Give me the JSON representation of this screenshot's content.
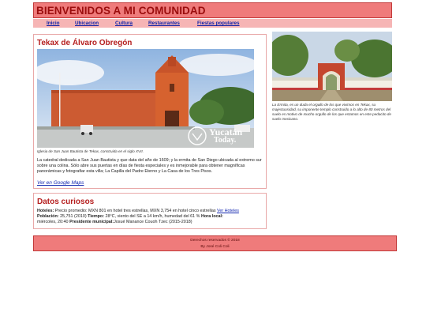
{
  "header": {
    "title": "BIENVENIDOS A MI COMUNIDAD"
  },
  "nav": {
    "items": [
      {
        "label": "Inicio"
      },
      {
        "label": "Ubicacion"
      },
      {
        "label": "Cultura"
      },
      {
        "label": "Restaurantes"
      },
      {
        "label": "Fiestas populares"
      }
    ]
  },
  "main": {
    "title": "Tekax de Álvaro Obregón",
    "photo_caption": "Iglesia de San Juan Bautista de Tekax, construida en el siglo XVII.",
    "watermark": {
      "brand": "Yucatán",
      "suffix": "Today."
    },
    "description": "La catedral dedicada a San Juan Bautista y que data del año de 1609; y la ermita de San Diego ubicada al extremo sur sobre una colina. Sólo abre sus puertas en días de fiesta especiales y es inmejorable para obtener magníficas panorámicas y fotografiar esta villa; La Capilla del Padre Eterno y La Casa de los Tres Pisos.",
    "maps_link": "Ver en Google Maps"
  },
  "side": {
    "caption": "La Ermita, es un duda el orgullo de los que vivimos en Tekax, su majestuosidad, su imponente templo construido a lo alto de 80 metros del suelo es motivo de mucho orgullo de los que estamos en este pedacito de suelo mexicano."
  },
  "facts": {
    "title": "Datos curiosos",
    "hotels_label": "Hoteles:",
    "hotels_text": "Precio promedio: MXN 801 en hotel tres estrellas, MXN 3,754 en hotel cinco estrellas",
    "hotels_link": "Ver Hoteles",
    "population_label": "Población:",
    "population_text": "25,751 (2010)",
    "weather_label": "Tiempo:",
    "weather_text": "28°C, viento del SE a 14 km/h, humedad del 61 %",
    "time_label": "Hora local:",
    "time_text": "miércoles, 20:40",
    "mayor_label": "Presidente municipal:",
    "mayor_text": "Josué Manance Couoh Tzec (2015-2018)"
  },
  "footer": {
    "rights": "Derechos reservados © 2018",
    "author": "By José Coli Coli"
  },
  "colors": {
    "header_bg": "#ef7b7b",
    "header_text": "#9b0d0d",
    "nav_bg": "#f6b5b5",
    "link": "#0f22a8",
    "heading": "#b51e1e"
  }
}
